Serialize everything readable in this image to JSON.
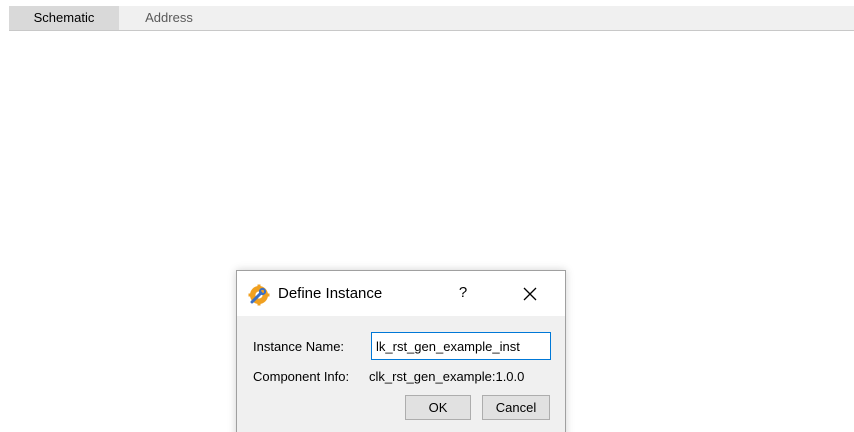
{
  "tabs": [
    {
      "label": "Schematic",
      "active": true
    },
    {
      "label": "Address",
      "active": false
    }
  ],
  "dialog": {
    "title": "Define Instance",
    "help_label": "?",
    "instance_name_label": "Instance Name:",
    "instance_name_value": "lk_rst_gen_example_inst",
    "component_info_label": "Component Info:",
    "component_info_value": "clk_rst_gen_example:1.0.0",
    "ok_label": "OK",
    "cancel_label": "Cancel",
    "icon": "wrench-gear-icon"
  },
  "colors": {
    "focus_border": "#0078d7",
    "active_tab": "#d9d9d9",
    "dialog_bg": "#f0f0f0"
  }
}
